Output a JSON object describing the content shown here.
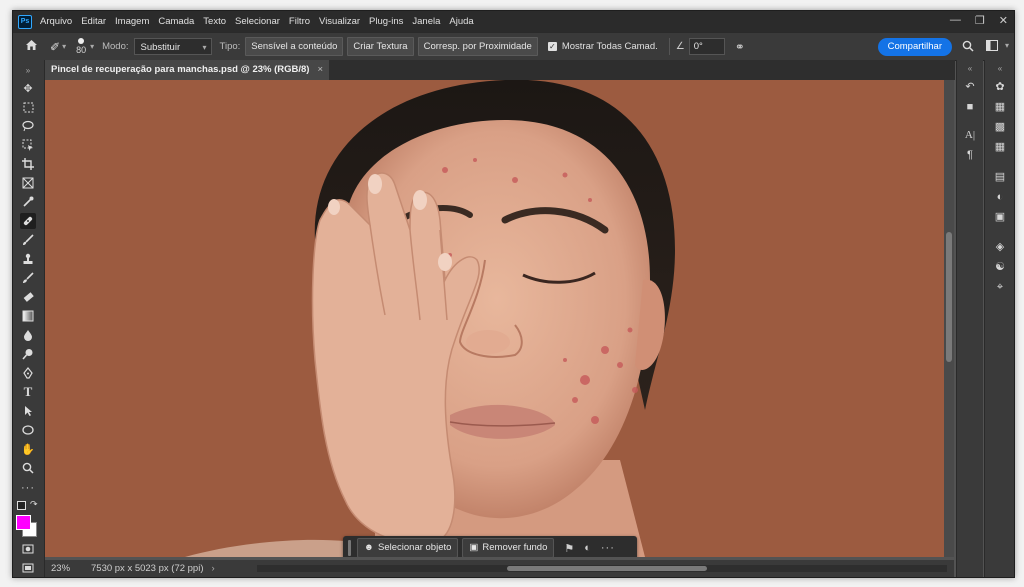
{
  "menubar": {
    "logo": "Ps",
    "items": [
      "Arquivo",
      "Editar",
      "Imagem",
      "Camada",
      "Texto",
      "Selecionar",
      "Filtro",
      "Visualizar",
      "Plug-ins",
      "Janela",
      "Ajuda"
    ]
  },
  "options": {
    "brush_size": "80",
    "mode_label": "Modo:",
    "mode_value": "Substituir",
    "type_label": "Tipo:",
    "type_buttons": [
      "Sensível a conteúdo",
      "Criar Textura",
      "Corresp. por Proximidade"
    ],
    "sample_all_label": "Mostrar Todas Camad.",
    "sample_all_checked": true,
    "angle_value": "0°",
    "share_label": "Compartilhar"
  },
  "document": {
    "tab_title": "Pincel de recuperação para manchas.psd @ 23% (RGB/8)"
  },
  "context_bar": {
    "select_object": "Selecionar objeto",
    "remove_bg": "Remover fundo"
  },
  "status": {
    "zoom": "23%",
    "doc_info": "7530 px x 5023 px (72 ppi)"
  },
  "colors": {
    "foreground": "#ff00ff",
    "background": "#ffffff",
    "canvas_bg": "#9c5b40",
    "accent": "#1473e6"
  }
}
